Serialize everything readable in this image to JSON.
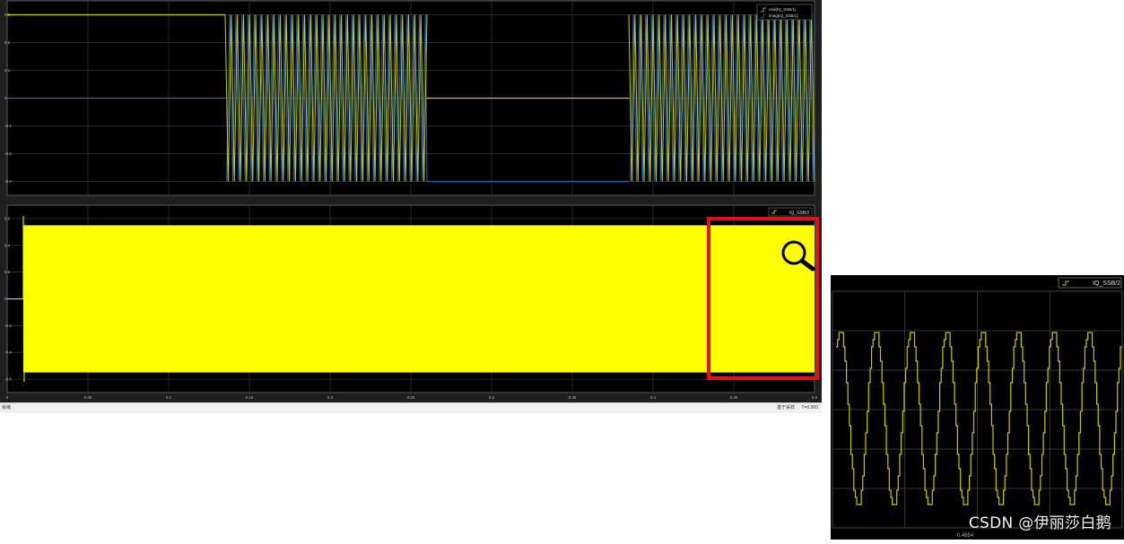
{
  "scope": {
    "status_left": "就绪",
    "status_sampling": "基于采样",
    "status_time": "T=0.500"
  },
  "watermark": "CSDN @伊丽莎白鹅",
  "chart_data": [
    {
      "type": "line",
      "panel": "top",
      "series": [
        {
          "name": "real(IQ_SSB/1)",
          "color": "#c8c820"
        },
        {
          "name": "imag(IQ_SSB/1)",
          "color": "#2a6aa8"
        }
      ],
      "x_segments": [
        {
          "x0": 0.0,
          "x1": 0.135,
          "state": "constant",
          "real": 0.3,
          "imag": 0.0
        },
        {
          "x0": 0.135,
          "x1": 0.26,
          "state": "oscillating",
          "amplitude": 0.3
        },
        {
          "x0": 0.26,
          "x1": 0.385,
          "state": "constant",
          "real": 0.0,
          "imag": -0.3
        },
        {
          "x0": 0.385,
          "x1": 0.5,
          "state": "oscillating",
          "amplitude": 0.3
        }
      ],
      "yticks": [
        "0.3",
        "0.2",
        "0.1",
        "0",
        "-0.1",
        "-0.2",
        "-0.3"
      ],
      "xlim": [
        0,
        0.5
      ],
      "ylim": [
        -0.35,
        0.35
      ],
      "grid": true,
      "legend": "top-right"
    },
    {
      "type": "line",
      "panel": "bottom",
      "series": [
        {
          "name": "IQ_SSB/2",
          "color": "#ffff00",
          "amplitude": 0.55,
          "appearance": "dense oscillation"
        }
      ],
      "yticks": [
        "0.6",
        "0.4",
        "0.2",
        "0",
        "-0.2",
        "-0.4",
        "-0.6"
      ],
      "xticks": [
        "0",
        "0.05",
        "0.1",
        "0.15",
        "0.2",
        "0.25",
        "0.3",
        "0.35",
        "0.4",
        "0.45",
        "0.5"
      ],
      "xlim": [
        0,
        0.5
      ],
      "ylim": [
        -0.7,
        0.7
      ],
      "grid": true,
      "legend": "top-right",
      "zoom_region": {
        "x0": 0.445,
        "x1": 0.5,
        "color": "#e0101c"
      }
    },
    {
      "type": "line",
      "panel": "zoom",
      "series": [
        {
          "name": "IQ_SSB/2",
          "color": "#c8c800",
          "cycles": 8,
          "appearance": "stepped sinusoid"
        }
      ],
      "xticks": [
        "0.4654"
      ],
      "grid": true,
      "legend": "top-right"
    }
  ]
}
